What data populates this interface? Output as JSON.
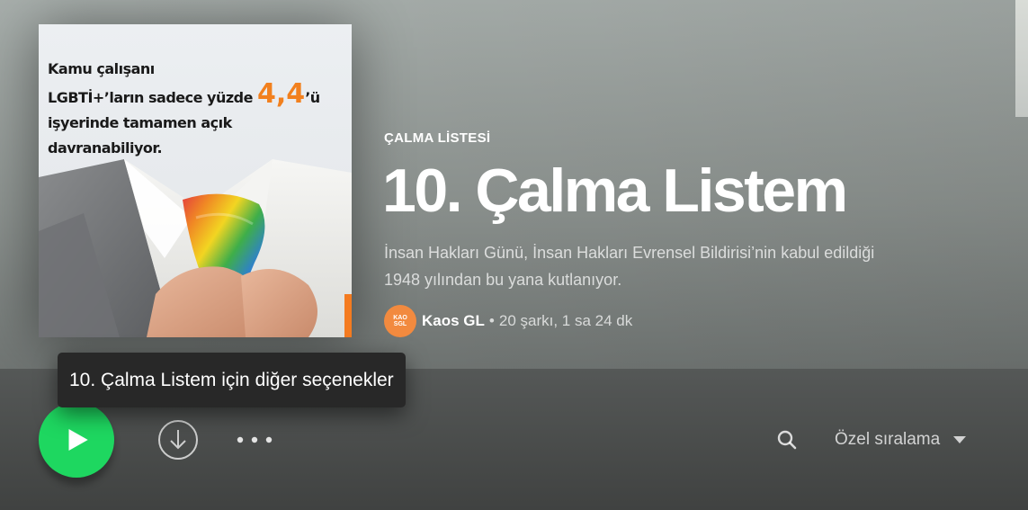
{
  "playlist": {
    "type_label": "ÇALMA LİSTESİ",
    "title": "10. Çalma Listem",
    "description_line1": "İnsan Hakları Günü, İnsan Hakları Evrensel Bildirisi’nin kabul edildiği",
    "description_line2": "1948 yılından bu yana kutlanıyor.",
    "owner": "Kaos GL",
    "owner_avatar_text": "KAOSGL",
    "separator": "•",
    "stats": "20 şarkı, 1 sa 24 dk"
  },
  "cover": {
    "line1": "Kamu çalışanı",
    "line2_prefix": "LGBTİ+’ların sadece yüzde ",
    "line2_number": "4,4",
    "line2_suffix": "’ü",
    "line3": "işyerinde tamamen açık davranabiliyor."
  },
  "tooltip": {
    "text": "10. Çalma Listem için diğer seçenekler"
  },
  "actions": {
    "sort_label": "Özel sıralama"
  },
  "icons": {
    "play": "play-icon",
    "download": "download-icon",
    "more": "more-dots-icon",
    "search": "search-icon",
    "sort_caret": "caret-down-icon"
  },
  "colors": {
    "accent_green": "#1ed760",
    "cover_orange": "#f2801e",
    "tooltip_bg": "#282828",
    "avatar_orange": "#f28a3f"
  }
}
